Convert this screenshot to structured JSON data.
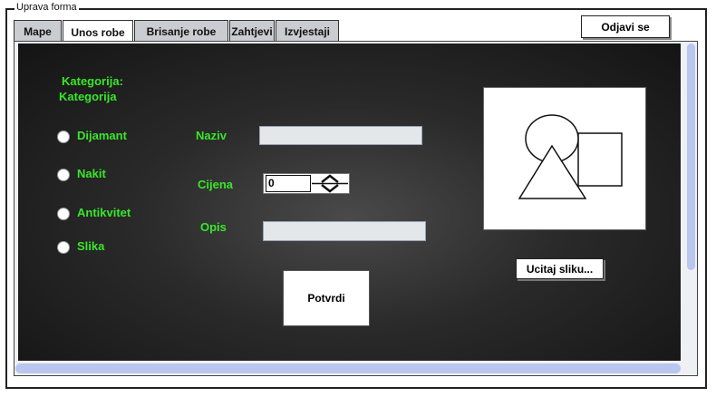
{
  "window": {
    "title": "Uprava forma"
  },
  "tabs": [
    {
      "label": "Mape",
      "active": false
    },
    {
      "label": "Unos robe",
      "active": true
    },
    {
      "label": "Brisanje robe",
      "active": false
    },
    {
      "label": "Zahtjevi",
      "active": false
    },
    {
      "label": "Izvjestaji",
      "active": false
    }
  ],
  "header": {
    "logout_label": "Odjavi se"
  },
  "category": {
    "heading_line1": "Kategorija:",
    "heading_line2": "Kategorija",
    "options": [
      "Dijamant",
      "Nakit",
      "Antikvitet",
      "Slika"
    ]
  },
  "form": {
    "name_label": "Naziv",
    "name_value": "",
    "price_label": "Cijena",
    "price_value": "0",
    "description_label": "Opis",
    "description_value": "",
    "confirm_label": "Potvrdi"
  },
  "image": {
    "load_label": "Ucitaj sliku..."
  },
  "colors": {
    "label_green": "#39e62a",
    "scroll_thumb": "#b9c6ef"
  }
}
